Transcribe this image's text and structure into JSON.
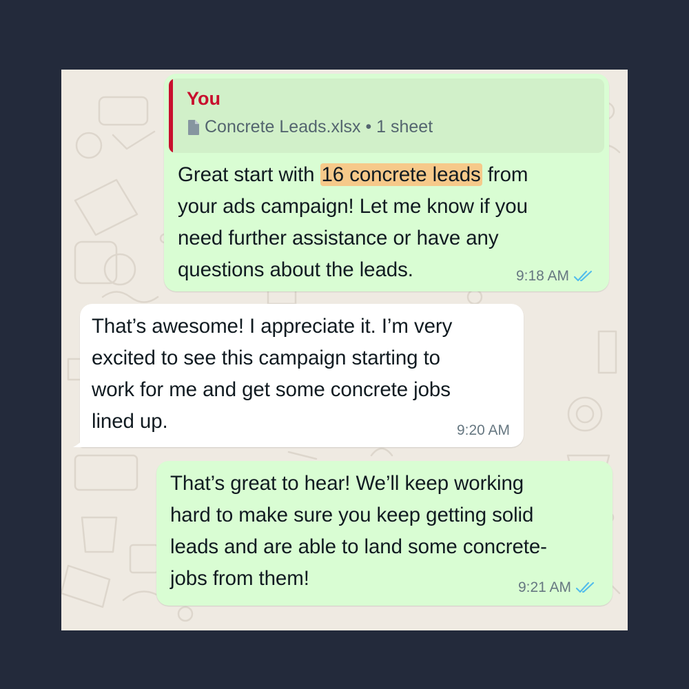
{
  "colors": {
    "outgoing_bubble": "#d9fdd3",
    "incoming_bubble": "#ffffff",
    "chat_background": "#efeae2",
    "quote_accent": "#c8102e",
    "highlight": "#f6c98a",
    "read_ticks": "#53bdeb"
  },
  "messages": [
    {
      "direction": "outgoing",
      "quote": {
        "author": "You",
        "file_icon": "document-icon",
        "file_text": "Concrete Leads.xlsx • 1 sheet"
      },
      "text_before": "Great start with ",
      "highlight": "16 concrete leads",
      "text_after": " from\nyour ads campaign! Let me know if you\nneed further assistance or have any\nquestions about the leads.",
      "time": "9:18 AM",
      "status_icon": "double-check-read-icon"
    },
    {
      "direction": "incoming",
      "text": "That’s awesome! I appreciate it. I’m very\nexcited to see this campaign starting to\nwork for me and get some concrete jobs\nlined up.",
      "time": "9:20 AM"
    },
    {
      "direction": "outgoing",
      "text": "That’s great to hear! We’ll keep working\nhard to make sure you keep getting solid\nleads and are able to land some concrete-\njobs from them!",
      "time": "9:21 AM",
      "status_icon": "double-check-read-icon"
    }
  ]
}
